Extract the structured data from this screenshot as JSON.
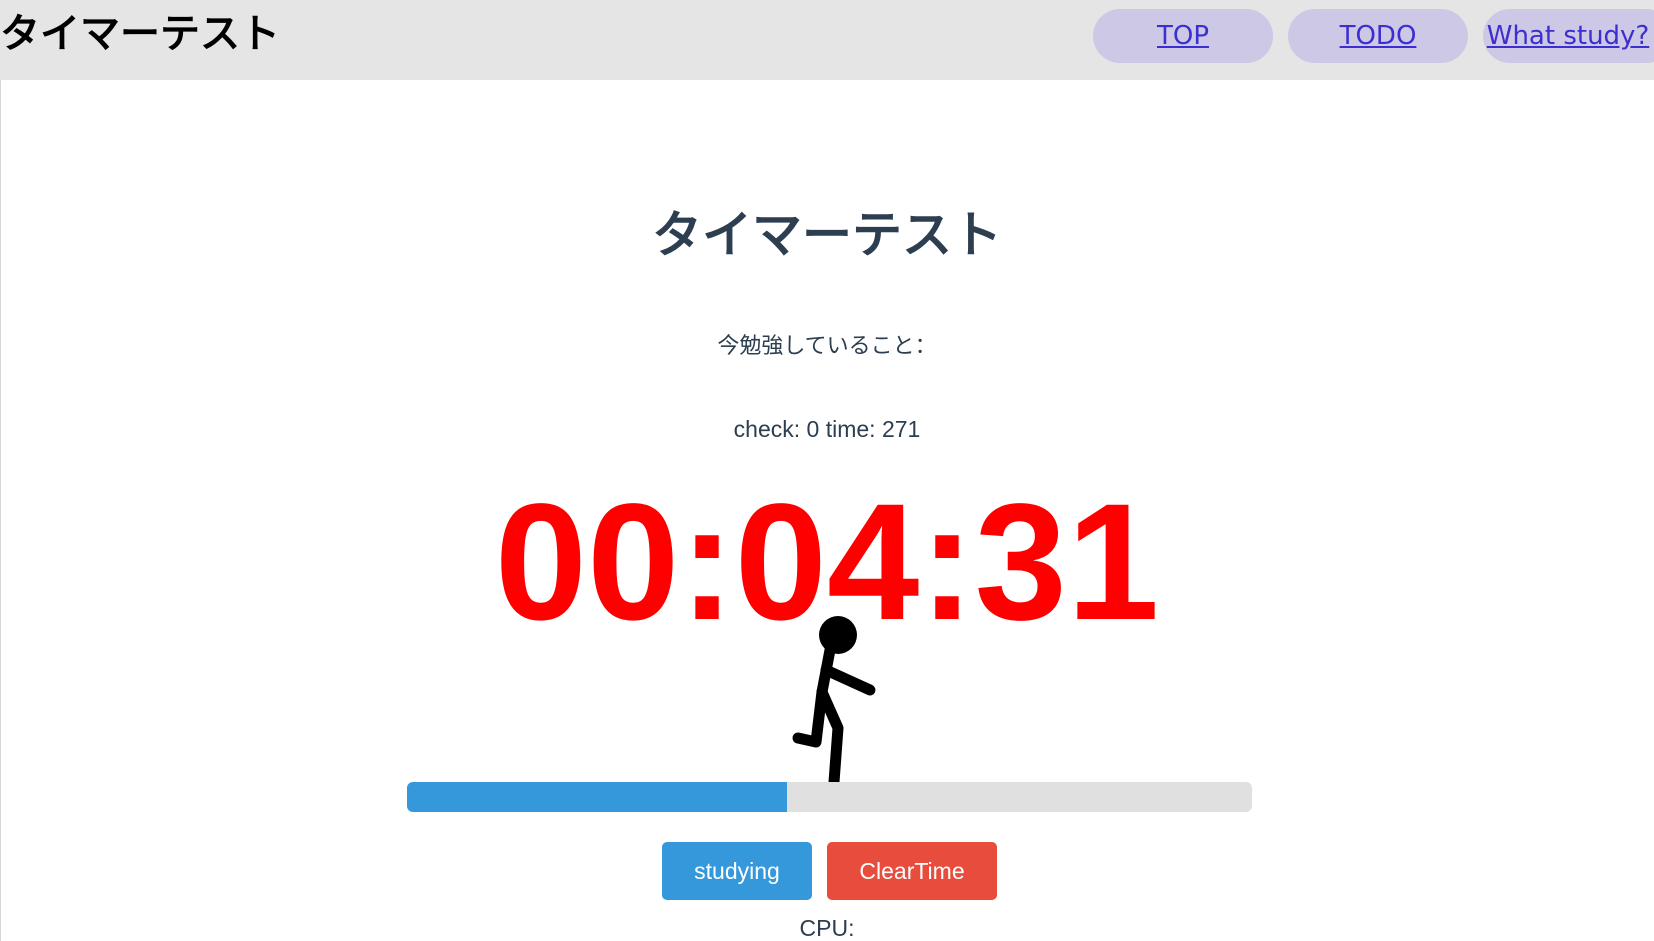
{
  "header": {
    "site_title": "タイマーテスト",
    "nav": [
      {
        "label": "TOP"
      },
      {
        "label": "TODO"
      },
      {
        "label": "What study?"
      }
    ]
  },
  "main": {
    "heading": "タイマーテスト",
    "studying_label": "今勉強していること：",
    "check_line": "check: 0 time: 271",
    "timer": "00:04:31",
    "progress_fraction": 0.45,
    "buttons": {
      "studying": "studying",
      "clear": "ClearTime"
    },
    "cpu_label": "CPU:"
  },
  "colors": {
    "header_bg": "#e5e5e5",
    "nav_pill_bg": "#cdc8e6",
    "nav_link": "#3b2fd0",
    "heading": "#2c3e50",
    "timer": "#ff0000",
    "progress_fill": "#3498db",
    "progress_track": "#e0e0e0",
    "studying_button": "#3498db",
    "clear_button": "#e74c3c"
  }
}
